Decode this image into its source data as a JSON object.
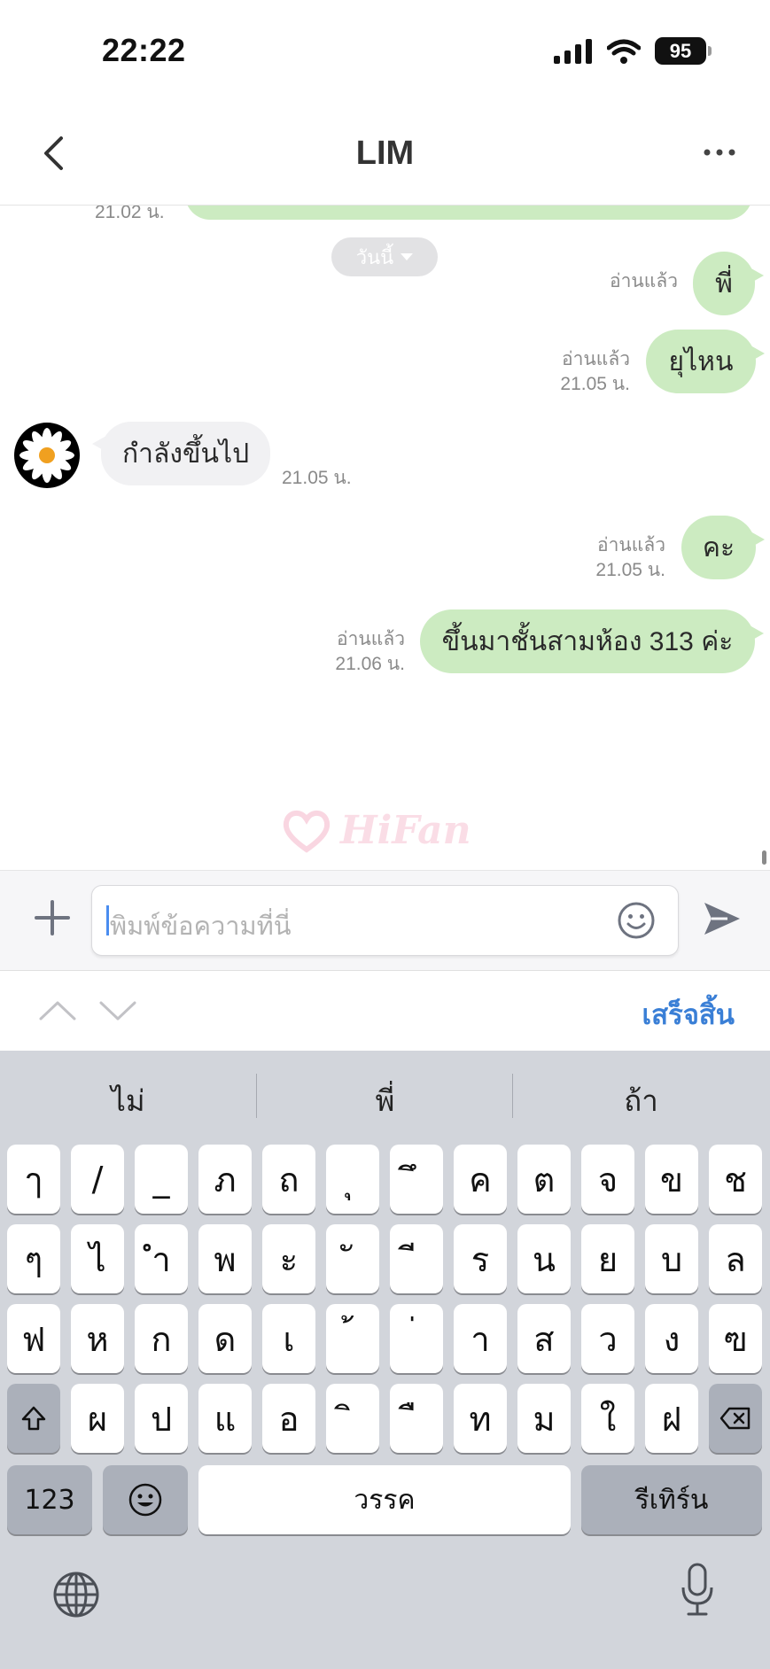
{
  "status_bar": {
    "time": "22:22",
    "battery": "95"
  },
  "header": {
    "title": "LIM"
  },
  "chat": {
    "partial_time": "21.02 น.",
    "date_pill": "วันนี้",
    "messages": [
      {
        "direction": "out",
        "text": "พี่",
        "read": "อ่านแล้ว",
        "time": ""
      },
      {
        "direction": "out",
        "text": "ยุไหน",
        "read": "อ่านแล้ว",
        "time": "21.05 น."
      },
      {
        "direction": "in",
        "text": "กำลังขึ้นไป",
        "read": "",
        "time": "21.05 น."
      },
      {
        "direction": "out",
        "text": "คะ",
        "read": "อ่านแล้ว",
        "time": "21.05 น."
      },
      {
        "direction": "out",
        "text": "ขึ้นมาชั้นสามห้อง 313 ค่ะ",
        "read": "อ่านแล้ว",
        "time": "21.06 น."
      }
    ],
    "watermark": "HiFan"
  },
  "input": {
    "placeholder": "พิมพ์ข้อความที่นี่"
  },
  "search_nav": {
    "done_label": "เสร็จสิ้น"
  },
  "keyboard": {
    "suggestions": [
      "ไม่",
      "พี่",
      "ถ้า"
    ],
    "row1": [
      "ๅ",
      "/",
      "_",
      "ภ",
      "ถ",
      "ุ",
      "ึ",
      "ค",
      "ต",
      "จ",
      "ข",
      "ช"
    ],
    "row2": [
      "ๆ",
      "ไ",
      "ำ",
      "พ",
      "ะ",
      "ั",
      "ี",
      "ร",
      "น",
      "ย",
      "บ",
      "ล"
    ],
    "row3": [
      "ฟ",
      "ห",
      "ก",
      "ด",
      "เ",
      "้",
      "่",
      "า",
      "ส",
      "ว",
      "ง",
      "ฃ"
    ],
    "row4": [
      "ผ",
      "ป",
      "แ",
      "อ",
      "ิ",
      "ื",
      "ท",
      "ม",
      "ใ",
      "ฝ"
    ],
    "numbers_label": "123",
    "space_label": "วรรค",
    "return_label": "รีเทิร์น"
  }
}
